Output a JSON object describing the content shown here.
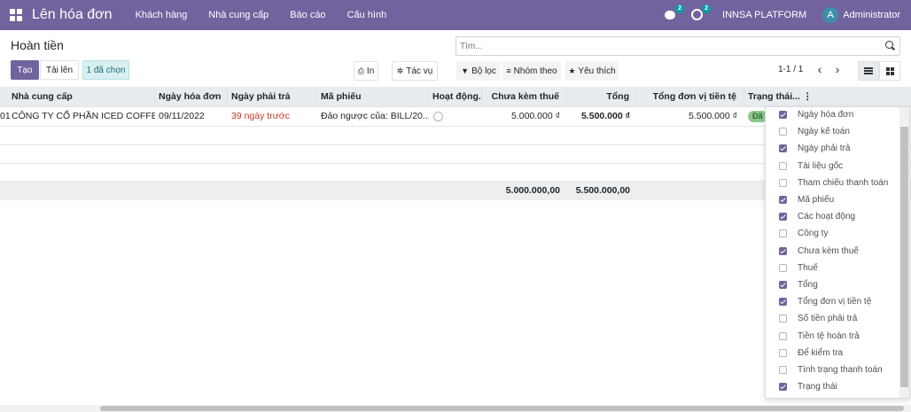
{
  "topbar": {
    "app_title": "Lên hóa đơn",
    "menu": [
      "Khách hàng",
      "Nhà cung cấp",
      "Báo cáo",
      "Cấu hình"
    ],
    "messages_badge": "2",
    "activities_badge": "2",
    "company": "INNSA PLATFORM",
    "avatar_letter": "A",
    "user": "Administrator",
    "color": "#71639e"
  },
  "control": {
    "breadcrumb": "Hoàn tiền",
    "search_placeholder": "Tìm...",
    "create": "Tạo",
    "upload": "Tải lên",
    "selected": "1 đã chọn",
    "print": "In",
    "action": "Tác vụ",
    "filter": "Bộ lọc",
    "group_by": "Nhóm theo",
    "favorites": "Yêu thích",
    "pager": "1-1 / 1"
  },
  "table": {
    "columns": [
      "Nhà cung cấp",
      "Ngày hóa đơn",
      "Ngày phải trả",
      "Mã phiếu",
      "Hoạt động...",
      "Chưa kèm thuế",
      "Tổng",
      "Tổng đơn vị tiền tệ",
      "Trạng thái..."
    ],
    "row": {
      "index_prefix": "01",
      "vendor": "CÔNG TY CỔ PHẦN ICED COFFEE",
      "invoice_date": "09/11/2022",
      "due": "39 ngày trước",
      "ref": "Đảo ngược của: BILL/20...",
      "untaxed": "5.000.000 ₫",
      "total": "5.500.000 ₫",
      "total_currency": "5.500.000 ₫",
      "status": "Đã"
    },
    "footer": {
      "untaxed": "5.000.000,00",
      "total": "5.500.000,00"
    }
  },
  "columns_menu": [
    {
      "label": "Ngày hóa đơn",
      "checked": true
    },
    {
      "label": "Ngày kế toán",
      "checked": false
    },
    {
      "label": "Ngày phải trả",
      "checked": true
    },
    {
      "label": "Tài liệu gốc",
      "checked": false
    },
    {
      "label": "Tham chiếu thanh toán",
      "checked": false
    },
    {
      "label": "Mã phiếu",
      "checked": true
    },
    {
      "label": "Các hoạt động",
      "checked": true
    },
    {
      "label": "Công ty",
      "checked": false
    },
    {
      "label": "Chưa kèm thuế",
      "checked": true
    },
    {
      "label": "Thuế",
      "checked": false
    },
    {
      "label": "Tổng",
      "checked": true
    },
    {
      "label": "Tổng đơn vị tiền tệ",
      "checked": true
    },
    {
      "label": "Số tiền phải trả",
      "checked": false
    },
    {
      "label": "Tiền tệ hoàn trả",
      "checked": false
    },
    {
      "label": "Để kiểm tra",
      "checked": false
    },
    {
      "label": "Tình trạng thanh toán",
      "checked": false
    },
    {
      "label": "Trạng thái",
      "checked": true
    }
  ]
}
